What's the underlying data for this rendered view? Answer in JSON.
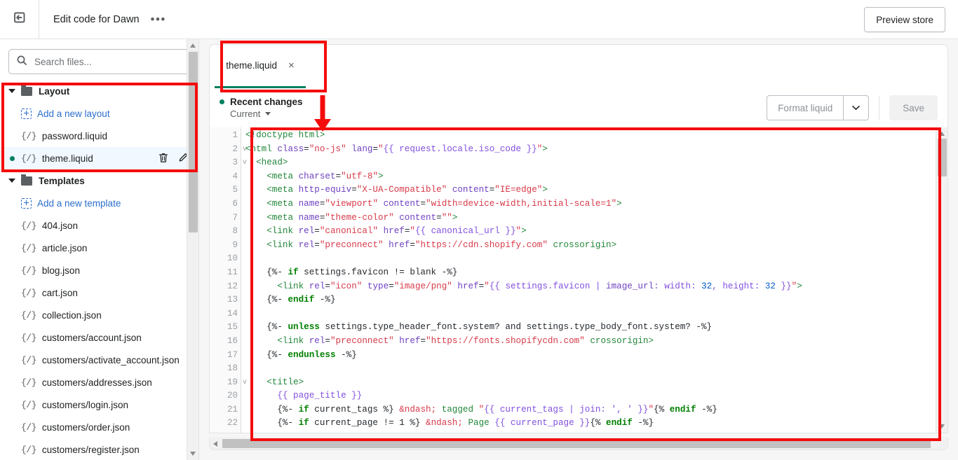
{
  "topbar": {
    "back_icon": "exit-left-icon",
    "title": "Edit code for Dawn",
    "more_label": "•••",
    "preview_label": "Preview store"
  },
  "sidebar": {
    "search": {
      "placeholder": "Search files...",
      "value": "",
      "icon": "search-icon"
    },
    "groups": [
      {
        "label": "Layout",
        "icon": "folder-icon",
        "items": [
          {
            "label": "Add a new layout",
            "kind": "add",
            "icon": "add-file-icon"
          },
          {
            "label": "password.liquid",
            "kind": "file",
            "icon": "liquid-file-icon"
          },
          {
            "label": "theme.liquid",
            "kind": "file",
            "icon": "liquid-file-icon",
            "selected": true,
            "modified": true,
            "actions": [
              "delete-icon",
              "rename-icon"
            ]
          }
        ]
      },
      {
        "label": "Templates",
        "icon": "folder-icon",
        "items": [
          {
            "label": "Add a new template",
            "kind": "add",
            "icon": "add-file-icon"
          },
          {
            "label": "404.json",
            "kind": "file",
            "icon": "liquid-file-icon"
          },
          {
            "label": "article.json",
            "kind": "file",
            "icon": "liquid-file-icon"
          },
          {
            "label": "blog.json",
            "kind": "file",
            "icon": "liquid-file-icon"
          },
          {
            "label": "cart.json",
            "kind": "file",
            "icon": "liquid-file-icon"
          },
          {
            "label": "collection.json",
            "kind": "file",
            "icon": "liquid-file-icon"
          },
          {
            "label": "customers/account.json",
            "kind": "file",
            "icon": "liquid-file-icon"
          },
          {
            "label": "customers/activate_account.json",
            "kind": "file",
            "icon": "liquid-file-icon"
          },
          {
            "label": "customers/addresses.json",
            "kind": "file",
            "icon": "liquid-file-icon"
          },
          {
            "label": "customers/login.json",
            "kind": "file",
            "icon": "liquid-file-icon"
          },
          {
            "label": "customers/order.json",
            "kind": "file",
            "icon": "liquid-file-icon"
          },
          {
            "label": "customers/register.json",
            "kind": "file",
            "icon": "liquid-file-icon"
          }
        ]
      }
    ]
  },
  "editor": {
    "tab": {
      "label": "theme.liquid",
      "close_label": "×",
      "accent_color": "#007f5f"
    },
    "recent_changes_label": "Recent changes",
    "version_label": "Current",
    "format_label": "Format liquid",
    "format_caret_icon": "chevron-down-icon",
    "save_label": "Save",
    "line_numbers": [
      "1",
      "2",
      "3",
      "4",
      "5",
      "6",
      "7",
      "8",
      "9",
      "10",
      "11",
      "12",
      "13",
      "14",
      "15",
      "16",
      "17",
      "18",
      "19",
      "20",
      "21",
      "22"
    ],
    "fold_lines": [
      2,
      3,
      19
    ],
    "code_lines": [
      "<!doctype html>",
      "<html class=\"no-js\" lang=\"{{ request.locale.iso_code }}\">",
      "  <head>",
      "    <meta charset=\"utf-8\">",
      "    <meta http-equiv=\"X-UA-Compatible\" content=\"IE=edge\">",
      "    <meta name=\"viewport\" content=\"width=device-width,initial-scale=1\">",
      "    <meta name=\"theme-color\" content=\"\">",
      "    <link rel=\"canonical\" href=\"{{ canonical_url }}\">",
      "    <link rel=\"preconnect\" href=\"https://cdn.shopify.com\" crossorigin>",
      "",
      "    {%- if settings.favicon != blank -%}",
      "      <link rel=\"icon\" type=\"image/png\" href=\"{{ settings.favicon | image_url: width: 32, height: 32 }}\">",
      "    {%- endif -%}",
      "",
      "    {%- unless settings.type_header_font.system? and settings.type_body_font.system? -%}",
      "      <link rel=\"preconnect\" href=\"https://fonts.shopifycdn.com\" crossorigin>",
      "    {%- endunless -%}",
      "",
      "    <title>",
      "      {{ page_title }}",
      "      {%- if current_tags %} &ndash; tagged \"{{ current_tags | join: ', ' }}\"{% endif -%}",
      "      {%- if current_page != 1 %} &ndash; Page {{ current_page }}{% endif -%}"
    ]
  },
  "annotations": {
    "color": "#f40c0c",
    "boxes": [
      {
        "name": "layout-group-highlight"
      },
      {
        "name": "tab-highlight"
      },
      {
        "name": "code-area-highlight"
      }
    ],
    "arrows": [
      {
        "name": "down-arrow-to-code"
      }
    ]
  }
}
